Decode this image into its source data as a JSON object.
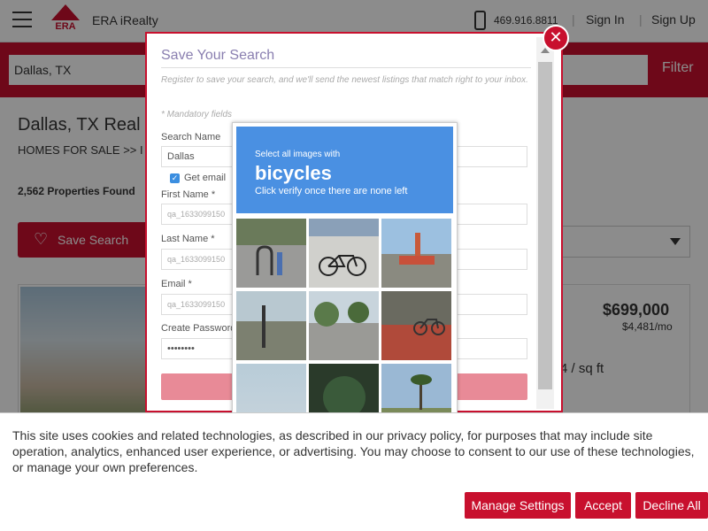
{
  "header": {
    "logo_text": "ERA",
    "brand_name": "ERA iRealty",
    "phone": "469.916.8811",
    "sign_in": "Sign In",
    "sign_up": "Sign Up"
  },
  "search": {
    "value": "Dallas, TX",
    "filter_label": "Filter"
  },
  "page": {
    "title": "Dallas, TX Real",
    "breadcrumb": "HOMES FOR SALE  >>  I",
    "count": "2,562 Properties Found",
    "save_search_label": "Save Search"
  },
  "listing": {
    "price": "$699,000",
    "price_mo": "$4,481/mo",
    "sqft": "4 / sq ft"
  },
  "modal": {
    "title": "Save Your Search",
    "subtitle": "Register to save your search, and we'll send the newest listings that match right to your inbox.",
    "mandatory": "* Mandatory fields",
    "search_name_label": "Search Name",
    "search_name_value": "Dallas",
    "get_email_label": "Get email",
    "first_name_label": "First Name *",
    "first_name_value": "qa_1633099150",
    "last_name_label": "Last Name *",
    "last_name_value": "qa_1633099150",
    "email_label": "Email *",
    "email_value": "qa_1633099150",
    "password_label": "Create Password",
    "password_value": "••••••••"
  },
  "captcha": {
    "line1": "Select all images with",
    "target": "bicycles",
    "line3": "Click verify once there are none left"
  },
  "cookie": {
    "text": "This site uses cookies and related technologies, as described in our privacy policy, for purposes that may include site operation, analytics, enhanced user experience, or advertising. You may choose to consent to our use of these technologies, or manage your own preferences.",
    "manage_label": "Manage Settings",
    "accept_label": "Accept",
    "decline_label": "Decline All"
  },
  "colors": {
    "brand_red": "#c8102e",
    "captcha_blue": "#4a90e2",
    "modal_title": "#8a7fb0"
  }
}
